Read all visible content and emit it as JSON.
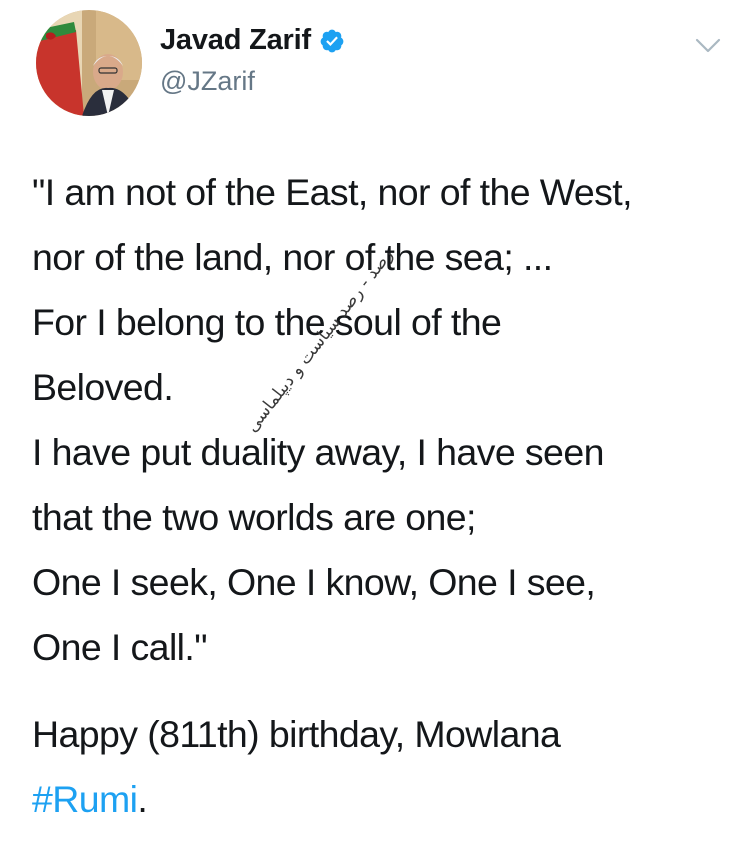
{
  "author": {
    "display_name": "Javad Zarif",
    "handle": "@JZarif",
    "verified": true
  },
  "tweet": {
    "lines": [
      "\"I am not of the East, nor of the West,",
      "nor of the land, nor of the sea; ...",
      "For I belong to the soul of the",
      "Beloved.",
      "I have put duality away, I have seen",
      "that the two worlds are one;",
      "One I seek, One I know, One I see,",
      "One I call.\""
    ],
    "closing_line_1": "Happy (811th) birthday, Mowlana",
    "hashtag": "#Rumi",
    "closing_punct": "."
  },
  "watermark": {
    "text": "رصد - رصد سیاست و دیپلماسی"
  },
  "colors": {
    "text": "#14171a",
    "secondary": "#657786",
    "link": "#1da1f2",
    "verified_badge": "#1da1f2"
  },
  "icons": {
    "verified": "verified-badge-icon",
    "caret": "chevron-down-icon"
  }
}
